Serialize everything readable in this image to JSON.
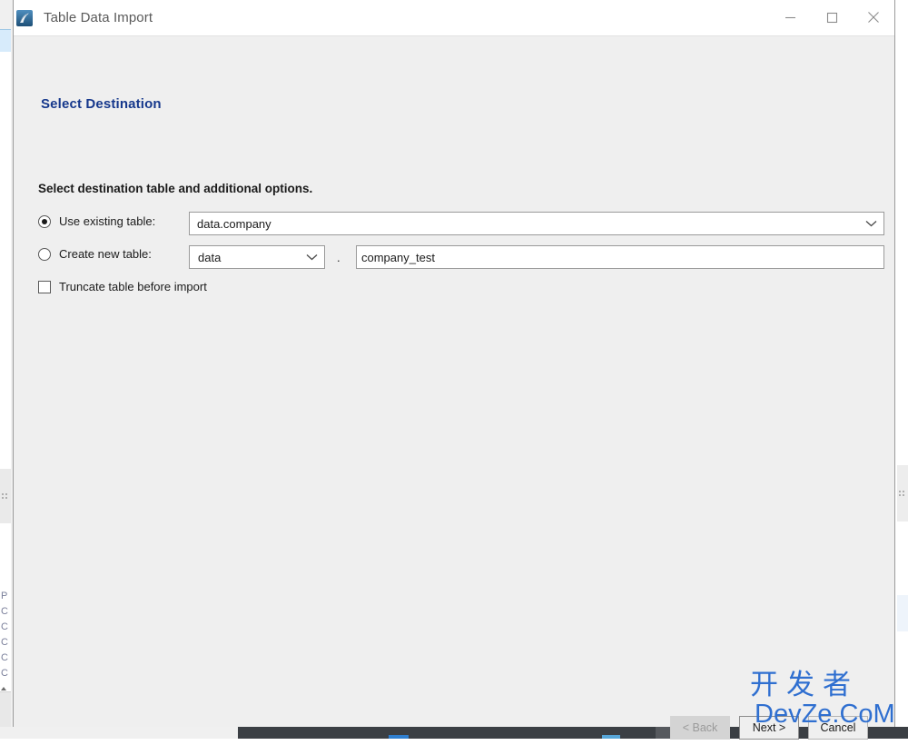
{
  "window": {
    "title": "Table Data Import",
    "icon": "workbench-icon",
    "controls": {
      "minimize": "minimize-icon",
      "maximize": "maximize-icon",
      "close": "close-icon"
    }
  },
  "wizard": {
    "heading": "Select Destination",
    "section_label": "Select destination table and additional options.",
    "options": {
      "use_existing_label": "Use existing table:",
      "use_existing_selected": true,
      "existing_table_value": "data.company",
      "create_new_label": "Create new table:",
      "create_new_selected": false,
      "new_schema_value": "data",
      "separator": ".",
      "new_table_value": "company_test",
      "truncate_label": "Truncate table before import",
      "truncate_checked": false
    }
  },
  "buttons": {
    "back": "< Back",
    "next": "Next >",
    "cancel": "Cancel"
  },
  "watermark": {
    "line1": "开发者",
    "line2": "DevZe.CoM",
    "color": "#2f6fd0"
  },
  "background_app": {
    "left_rows": [
      "P",
      "C",
      "C",
      "C",
      "C",
      "C"
    ]
  },
  "colors": {
    "heading": "#16388c",
    "dialog_bg": "#efefef",
    "titlebar_bg": "#ffffff",
    "field_bg": "#ffffff",
    "border": "#9a9a9a"
  }
}
